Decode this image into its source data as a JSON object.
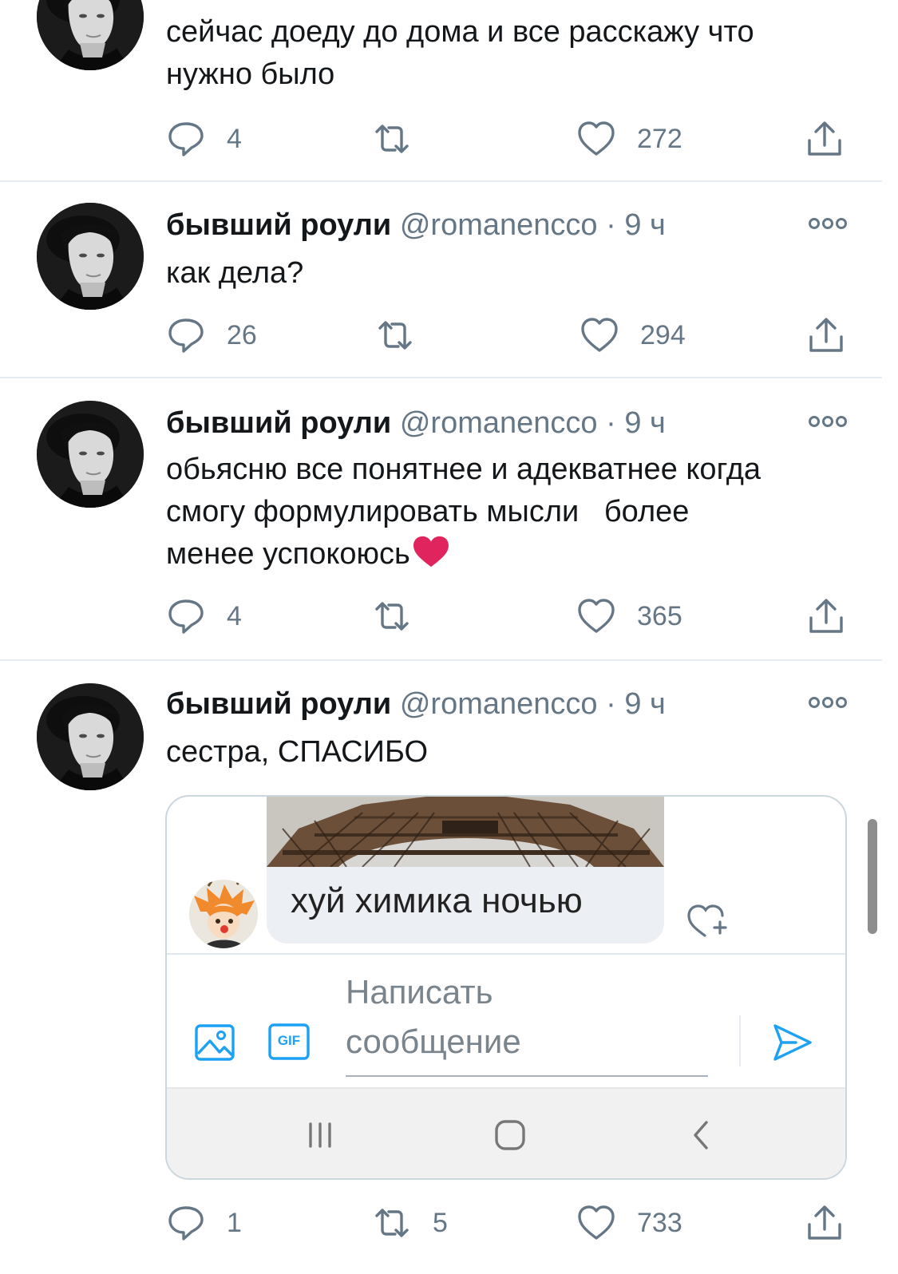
{
  "tweets": [
    {
      "name": "",
      "handle": "",
      "time": "",
      "text_lines": [
        "сейчас доеду до дома и все расскажу что",
        "нужно было"
      ],
      "replies": "4",
      "retweets": "",
      "likes": "272"
    },
    {
      "name": "бывший роули",
      "handle": "@romanencco",
      "dot": "·",
      "time": "9 ч",
      "text_lines": [
        "как дела?"
      ],
      "replies": "26",
      "retweets": "",
      "likes": "294"
    },
    {
      "name": "бывший роули",
      "handle": "@romanencco",
      "dot": "·",
      "time": "9 ч",
      "text_lines": [
        "обьясню все понятнее и адекватнее когда",
        "смогу формулировать мысли   более",
        "менее успокоюсь"
      ],
      "emoji": "red-heart",
      "replies": "4",
      "retweets": "",
      "likes": "365"
    },
    {
      "name": "бывший роули",
      "handle": "@romanencco",
      "dot": "·",
      "time": "9 ч",
      "text_lines": [
        "сестра, СПАСИБО"
      ],
      "replies": "1",
      "retweets": "5",
      "likes": "733"
    }
  ],
  "embed": {
    "message_text": "хуй химика ночью",
    "compose_placeholder_lines": [
      "Написать",
      "сообщение"
    ],
    "gif_label": "GIF"
  },
  "colors": {
    "text": "#14171a",
    "muted": "#657786",
    "icon": "#657786",
    "divider": "#e6ecf0",
    "accent_blue": "#1da1f2",
    "heart_red": "#e0245e"
  },
  "icons": [
    "reply-icon",
    "retweet-icon",
    "like-icon",
    "share-icon",
    "more-icon",
    "image-icon",
    "gif-icon",
    "send-icon",
    "like-plus-icon",
    "nav-recents-icon",
    "nav-home-icon",
    "nav-back-icon"
  ]
}
